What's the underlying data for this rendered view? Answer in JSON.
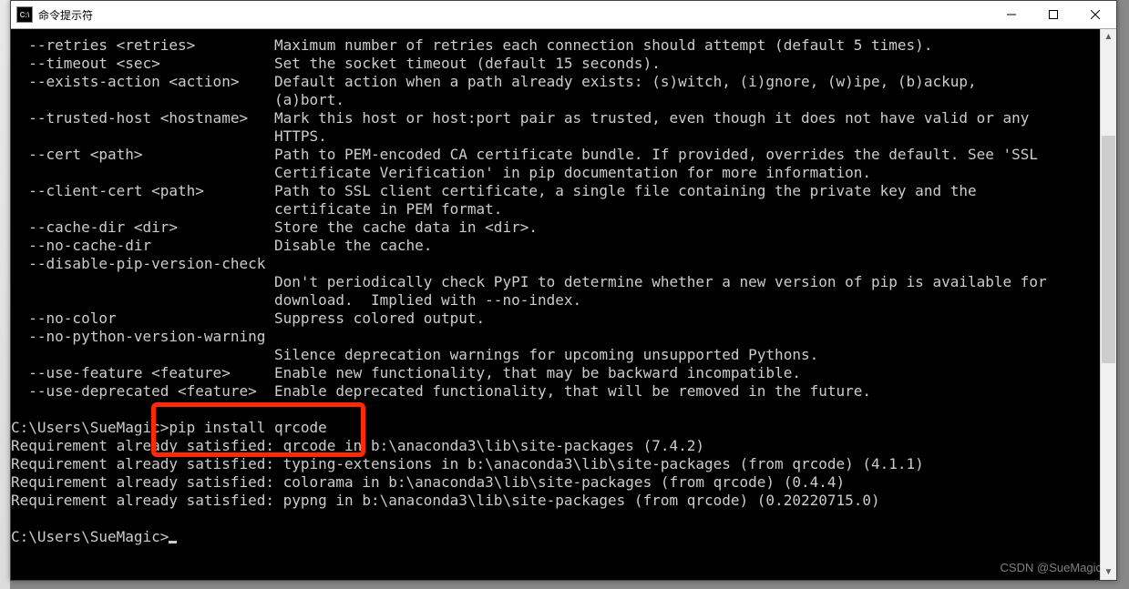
{
  "window": {
    "title": "命令提示符",
    "icon_label": "C:\\"
  },
  "terminal": {
    "lines": [
      "  --retries <retries>         Maximum number of retries each connection should attempt (default 5 times).",
      "  --timeout <sec>             Set the socket timeout (default 15 seconds).",
      "  --exists-action <action>    Default action when a path already exists: (s)witch, (i)gnore, (w)ipe, (b)ackup,",
      "                              (a)bort.",
      "  --trusted-host <hostname>   Mark this host or host:port pair as trusted, even though it does not have valid or any",
      "                              HTTPS.",
      "  --cert <path>               Path to PEM-encoded CA certificate bundle. If provided, overrides the default. See 'SSL",
      "                              Certificate Verification' in pip documentation for more information.",
      "  --client-cert <path>        Path to SSL client certificate, a single file containing the private key and the",
      "                              certificate in PEM format.",
      "  --cache-dir <dir>           Store the cache data in <dir>.",
      "  --no-cache-dir              Disable the cache.",
      "  --disable-pip-version-check",
      "                              Don't periodically check PyPI to determine whether a new version of pip is available for",
      "                              download.  Implied with --no-index.",
      "  --no-color                  Suppress colored output.",
      "  --no-python-version-warning",
      "                              Silence deprecation warnings for upcoming unsupported Pythons.",
      "  --use-feature <feature>     Enable new functionality, that may be backward incompatible.",
      "  --use-deprecated <feature>  Enable deprecated functionality, that will be removed in the future.",
      "",
      "C:\\Users\\SueMagic>pip install qrcode",
      "Requirement already satisfied: qrcode in b:\\anaconda3\\lib\\site-packages (7.4.2)",
      "Requirement already satisfied: typing-extensions in b:\\anaconda3\\lib\\site-packages (from qrcode) (4.1.1)",
      "Requirement already satisfied: colorama in b:\\anaconda3\\lib\\site-packages (from qrcode) (0.4.4)",
      "Requirement already satisfied: pypng in b:\\anaconda3\\lib\\site-packages (from qrcode) (0.20220715.0)",
      "",
      "C:\\Users\\SueMagic>"
    ],
    "highlight_command": "pip install qrcode",
    "prompt": "C:\\Users\\SueMagic>"
  },
  "watermark": "CSDN @SueMagic"
}
